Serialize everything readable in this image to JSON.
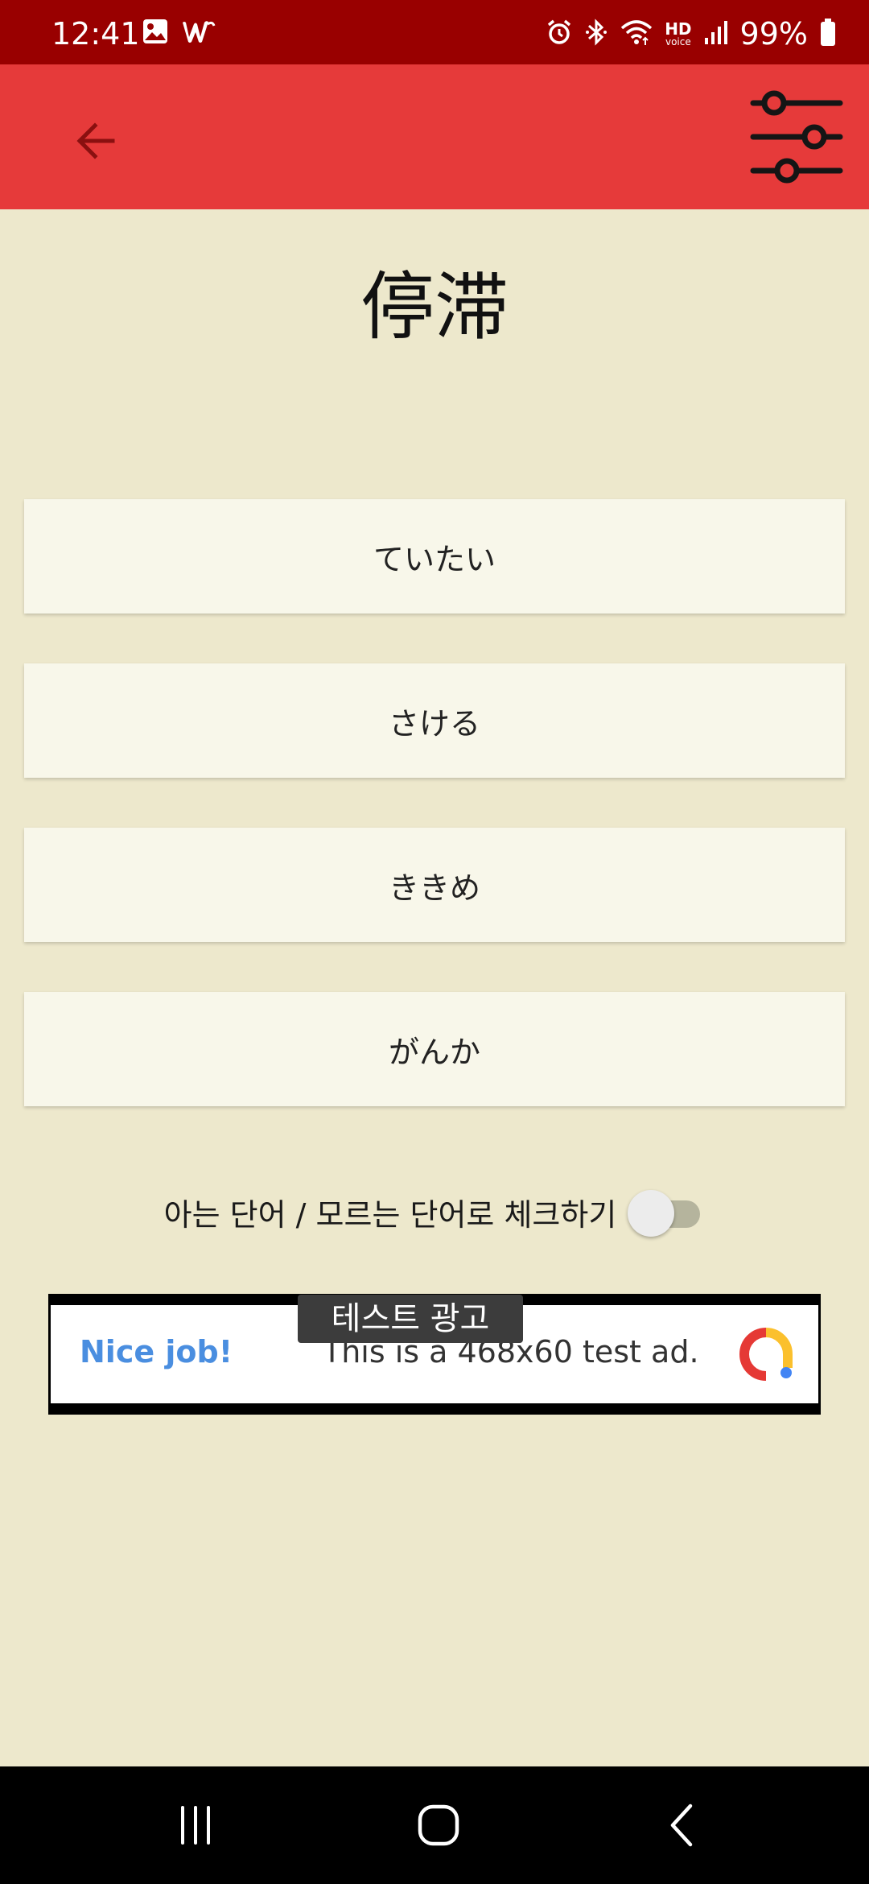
{
  "status_bar": {
    "time": "12:41",
    "battery": "99%",
    "icons": [
      "gallery-icon",
      "w-app-icon",
      "alarm-icon",
      "bluetooth-icon",
      "wifi-icon",
      "hd-voice-icon",
      "signal-icon",
      "battery-icon"
    ],
    "hd_label": "HD",
    "voice_label": "voice"
  },
  "app_bar": {
    "back_icon": "arrow-left-icon",
    "filter_icon": "sliders-icon"
  },
  "word": {
    "kanji": "停滞"
  },
  "options": [
    {
      "label": "ていたい"
    },
    {
      "label": "さける"
    },
    {
      "label": "ききめ"
    },
    {
      "label": "がんか"
    }
  ],
  "check": {
    "label": "아는 단어 / 모르는 단어로 체크하기",
    "toggle_on": false
  },
  "ad": {
    "badge": "테스트 광고",
    "headline": "Nice job!",
    "text": "This is a 468x60 test ad.",
    "colors": {
      "headline": "#4a8ee0"
    }
  },
  "nav_bar": {
    "icons": [
      "recents-icon",
      "home-icon",
      "back-icon"
    ]
  },
  "colors": {
    "status_bar": "#990000",
    "app_bar": "#e63a3a",
    "background": "#ede8cc",
    "option_bg": "#f8f7ea"
  }
}
